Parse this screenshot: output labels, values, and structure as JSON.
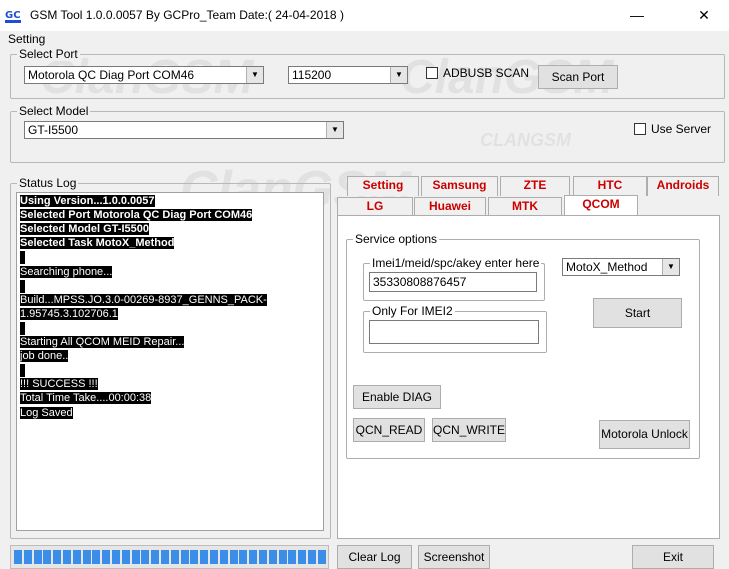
{
  "window": {
    "title": "GSM Tool 1.0.0.0057 By GCPro_Team  Date:( 24-04-2018 )",
    "icon_label": "GC",
    "minimize": "—",
    "close": "✕"
  },
  "menu": {
    "setting": "Setting"
  },
  "select_port": {
    "legend": "Select Port",
    "port_value": "Motorola QC Diag Port COM46",
    "baud_value": "115200",
    "adbusb_label": "ADBUSB SCAN",
    "scan_button": "Scan Port"
  },
  "select_model": {
    "legend": "Select Model",
    "model_value": "GT-I5500",
    "use_server_label": "Use Server"
  },
  "status_log": {
    "legend": "Status Log",
    "lines": [
      {
        "text": "Using Version...1.0.0.0057",
        "bold": true
      },
      {
        "text": "Selected Port Motorola QC Diag Port COM46",
        "bold": true
      },
      {
        "text": "Selected Model GT-I5500",
        "bold": true
      },
      {
        "text": "Selected Task MotoX_Method",
        "bold": true
      },
      {
        "text": "",
        "bold": false
      },
      {
        "text": "Searching phone...",
        "bold": false
      },
      {
        "text": "",
        "bold": false
      },
      {
        "text": "Build...MPSS.JO.3.0-00269-8937_GENNS_PACK-",
        "bold": false
      },
      {
        "text": "1.95745.3.102706.1",
        "bold": false
      },
      {
        "text": "",
        "bold": false
      },
      {
        "text": "Starting All QCOM MEID Repair...",
        "bold": false
      },
      {
        "text": "job done..",
        "bold": false
      },
      {
        "text": "",
        "bold": false
      },
      {
        "text": "!!! SUCCESS !!!",
        "bold": false
      },
      {
        "text": "Total Time Take....00:00:38",
        "bold": false
      },
      {
        "text": "Log Saved",
        "bold": false
      }
    ]
  },
  "tabs_row1": [
    "Setting",
    "Samsung",
    "ZTE",
    "HTC",
    "Androids"
  ],
  "tabs_row2": [
    "LG",
    "Huawei",
    "MTK",
    "QCOM"
  ],
  "qcom": {
    "service_legend": "Service options",
    "imei1_legend": "Imei1/meid/spc/akey enter here",
    "imei1_value": "35330808876457",
    "imei2_legend": "Only For IMEI2",
    "imei2_value": "",
    "method_value": "MotoX_Method",
    "start_button": "Start",
    "enable_diag_button": "Enable DIAG",
    "qcn_read_button": "QCN_READ",
    "qcn_write_button": "QCN_WRITE",
    "motorola_unlock_button": "Motorola Unlock"
  },
  "bottom": {
    "clear_log_button": "Clear Log",
    "screenshot_button": "Screenshot",
    "exit_button": "Exit",
    "progress": 1.0
  },
  "watermark": "ClanGSM",
  "watermark_small": "CLANGSM"
}
